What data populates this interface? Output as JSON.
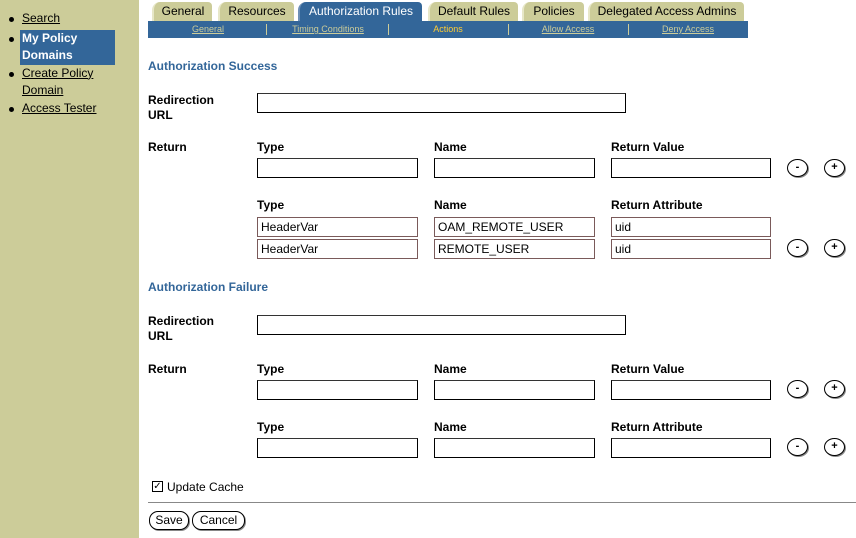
{
  "sidebar": {
    "items": [
      {
        "label": "Search"
      },
      {
        "label": "My Policy Domains"
      },
      {
        "label": "Create Policy Domain"
      },
      {
        "label": "Access Tester"
      }
    ]
  },
  "tabs": [
    {
      "label": "General"
    },
    {
      "label": "Resources"
    },
    {
      "label": "Authorization Rules"
    },
    {
      "label": "Default Rules"
    },
    {
      "label": "Policies"
    },
    {
      "label": "Delegated Access Admins"
    }
  ],
  "subtabs": [
    {
      "label": "General"
    },
    {
      "label": "Timing Conditions"
    },
    {
      "label": "Actions"
    },
    {
      "label": "Allow Access"
    },
    {
      "label": "Deny Access"
    }
  ],
  "success": {
    "title": "Authorization Success",
    "redirection_label": "Redirection URL",
    "redirection_value": "",
    "return_label": "Return",
    "value_row": {
      "type_header": "Type",
      "name_header": "Name",
      "value_header": "Return Value",
      "type": "",
      "name": "",
      "value": ""
    },
    "attr_header": {
      "type_header": "Type",
      "name_header": "Name",
      "attr_header": "Return Attribute"
    },
    "attr_rows": [
      {
        "type": "HeaderVar",
        "name": "OAM_REMOTE_USER",
        "attr": "uid"
      },
      {
        "type": "HeaderVar",
        "name": "REMOTE_USER",
        "attr": "uid"
      }
    ]
  },
  "failure": {
    "title": "Authorization Failure",
    "redirection_label": "Redirection URL",
    "redirection_value": "",
    "return_label": "Return",
    "value_row": {
      "type_header": "Type",
      "name_header": "Name",
      "value_header": "Return Value",
      "type": "",
      "name": "",
      "value": ""
    },
    "attr_row": {
      "type_header": "Type",
      "name_header": "Name",
      "attr_header": "Return Attribute",
      "type": "",
      "name": "",
      "attr": ""
    }
  },
  "controls": {
    "minus": "-",
    "plus": "+"
  },
  "update_cache": {
    "label": "Update Cache",
    "checked": true,
    "mark": "✓"
  },
  "buttons": {
    "save": "Save",
    "cancel": "Cancel"
  }
}
